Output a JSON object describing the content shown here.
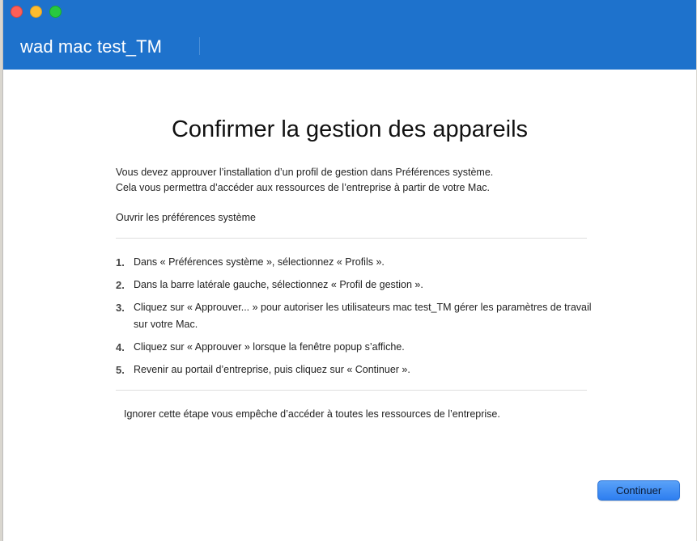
{
  "window": {
    "title": "wad mac test_TM"
  },
  "main": {
    "heading": "Confirmer la gestion des appareils",
    "intro_line1": "Vous devez approuver l’installation d’un profil de gestion dans Préférences système.",
    "intro_line2": "Cela vous permettra d’accéder aux ressources de l’entreprise à partir de votre Mac.",
    "open_prefs": "Ouvrir les préférences système",
    "steps": [
      {
        "num": "1.",
        "text": "Dans « Préférences système », sélectionnez « Profils »."
      },
      {
        "num": "2.",
        "text": "Dans la barre latérale gauche, sélectionnez « Profil de gestion »."
      },
      {
        "num": "3.",
        "text": "Cliquez sur « Approuver... » pour autoriser les utilisateurs mac test_TM gérer les paramètres de travail",
        "text2": "sur votre Mac."
      },
      {
        "num": "4.",
        "text": "Cliquez sur « Approuver » lorsque la fenêtre popup s’affiche."
      },
      {
        "num": "5.",
        "text": "Revenir au portail d’entreprise, puis cliquez sur « Continuer »."
      }
    ],
    "skip_note": "Ignorer cette étape vous empêche d’accéder à toutes les ressources de l’entreprise.",
    "continue_label": "Continuer"
  },
  "colors": {
    "titlebar": "#1e72cc",
    "button": "#2d7ef0"
  }
}
